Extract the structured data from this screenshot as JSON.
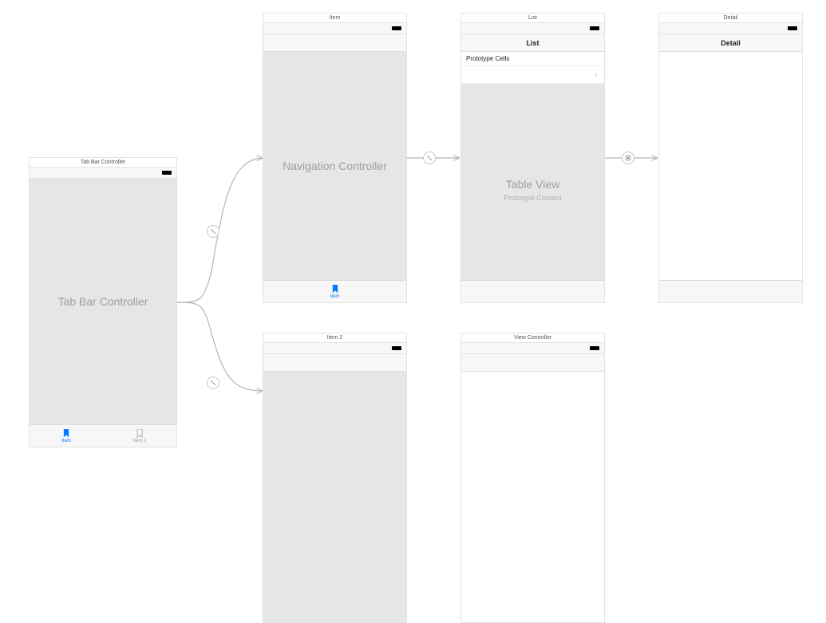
{
  "scenes": {
    "tabbar": {
      "header": "Tab Bar Controller",
      "placeholder": "Tab Bar Controller",
      "tabs": [
        {
          "label": "Item",
          "selected": true
        },
        {
          "label": "Item 2",
          "selected": false
        }
      ]
    },
    "nav_item": {
      "header": "Item",
      "placeholder": "Navigation Controller",
      "tab_label": "Item"
    },
    "list": {
      "header": "List",
      "nav_title": "List",
      "section_header": "Prototype Cells",
      "table_placeholder_title": "Table View",
      "table_placeholder_sub": "Prototype Content"
    },
    "detail": {
      "header": "Detail",
      "nav_title": "Detail"
    },
    "nav_item2": {
      "header": "Item 2"
    },
    "view_controller": {
      "header": "View Controller"
    }
  },
  "segues": {
    "relationship_r": "↘",
    "root_r": "↘",
    "show_r": "▣"
  }
}
